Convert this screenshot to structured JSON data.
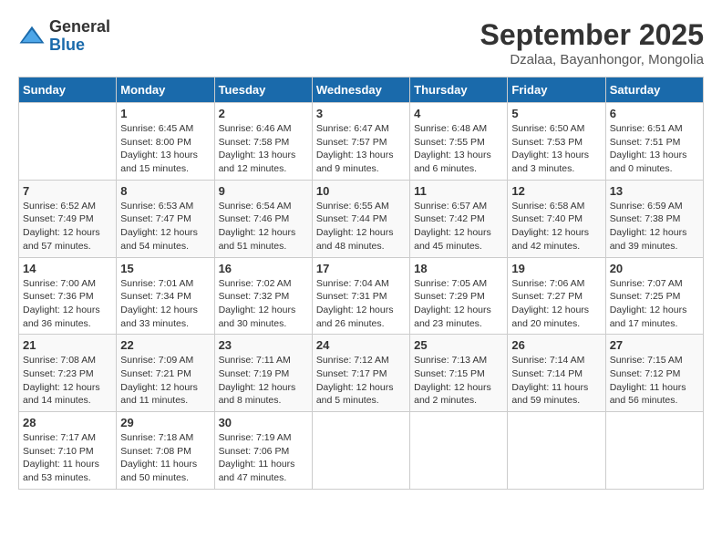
{
  "logo": {
    "general": "General",
    "blue": "Blue"
  },
  "title": "September 2025",
  "location": "Dzalaa, Bayanhongor, Mongolia",
  "headers": [
    "Sunday",
    "Monday",
    "Tuesday",
    "Wednesday",
    "Thursday",
    "Friday",
    "Saturday"
  ],
  "weeks": [
    [
      {
        "day": "",
        "info": ""
      },
      {
        "day": "1",
        "info": "Sunrise: 6:45 AM\nSunset: 8:00 PM\nDaylight: 13 hours\nand 15 minutes."
      },
      {
        "day": "2",
        "info": "Sunrise: 6:46 AM\nSunset: 7:58 PM\nDaylight: 13 hours\nand 12 minutes."
      },
      {
        "day": "3",
        "info": "Sunrise: 6:47 AM\nSunset: 7:57 PM\nDaylight: 13 hours\nand 9 minutes."
      },
      {
        "day": "4",
        "info": "Sunrise: 6:48 AM\nSunset: 7:55 PM\nDaylight: 13 hours\nand 6 minutes."
      },
      {
        "day": "5",
        "info": "Sunrise: 6:50 AM\nSunset: 7:53 PM\nDaylight: 13 hours\nand 3 minutes."
      },
      {
        "day": "6",
        "info": "Sunrise: 6:51 AM\nSunset: 7:51 PM\nDaylight: 13 hours\nand 0 minutes."
      }
    ],
    [
      {
        "day": "7",
        "info": "Sunrise: 6:52 AM\nSunset: 7:49 PM\nDaylight: 12 hours\nand 57 minutes."
      },
      {
        "day": "8",
        "info": "Sunrise: 6:53 AM\nSunset: 7:47 PM\nDaylight: 12 hours\nand 54 minutes."
      },
      {
        "day": "9",
        "info": "Sunrise: 6:54 AM\nSunset: 7:46 PM\nDaylight: 12 hours\nand 51 minutes."
      },
      {
        "day": "10",
        "info": "Sunrise: 6:55 AM\nSunset: 7:44 PM\nDaylight: 12 hours\nand 48 minutes."
      },
      {
        "day": "11",
        "info": "Sunrise: 6:57 AM\nSunset: 7:42 PM\nDaylight: 12 hours\nand 45 minutes."
      },
      {
        "day": "12",
        "info": "Sunrise: 6:58 AM\nSunset: 7:40 PM\nDaylight: 12 hours\nand 42 minutes."
      },
      {
        "day": "13",
        "info": "Sunrise: 6:59 AM\nSunset: 7:38 PM\nDaylight: 12 hours\nand 39 minutes."
      }
    ],
    [
      {
        "day": "14",
        "info": "Sunrise: 7:00 AM\nSunset: 7:36 PM\nDaylight: 12 hours\nand 36 minutes."
      },
      {
        "day": "15",
        "info": "Sunrise: 7:01 AM\nSunset: 7:34 PM\nDaylight: 12 hours\nand 33 minutes."
      },
      {
        "day": "16",
        "info": "Sunrise: 7:02 AM\nSunset: 7:32 PM\nDaylight: 12 hours\nand 30 minutes."
      },
      {
        "day": "17",
        "info": "Sunrise: 7:04 AM\nSunset: 7:31 PM\nDaylight: 12 hours\nand 26 minutes."
      },
      {
        "day": "18",
        "info": "Sunrise: 7:05 AM\nSunset: 7:29 PM\nDaylight: 12 hours\nand 23 minutes."
      },
      {
        "day": "19",
        "info": "Sunrise: 7:06 AM\nSunset: 7:27 PM\nDaylight: 12 hours\nand 20 minutes."
      },
      {
        "day": "20",
        "info": "Sunrise: 7:07 AM\nSunset: 7:25 PM\nDaylight: 12 hours\nand 17 minutes."
      }
    ],
    [
      {
        "day": "21",
        "info": "Sunrise: 7:08 AM\nSunset: 7:23 PM\nDaylight: 12 hours\nand 14 minutes."
      },
      {
        "day": "22",
        "info": "Sunrise: 7:09 AM\nSunset: 7:21 PM\nDaylight: 12 hours\nand 11 minutes."
      },
      {
        "day": "23",
        "info": "Sunrise: 7:11 AM\nSunset: 7:19 PM\nDaylight: 12 hours\nand 8 minutes."
      },
      {
        "day": "24",
        "info": "Sunrise: 7:12 AM\nSunset: 7:17 PM\nDaylight: 12 hours\nand 5 minutes."
      },
      {
        "day": "25",
        "info": "Sunrise: 7:13 AM\nSunset: 7:15 PM\nDaylight: 12 hours\nand 2 minutes."
      },
      {
        "day": "26",
        "info": "Sunrise: 7:14 AM\nSunset: 7:14 PM\nDaylight: 11 hours\nand 59 minutes."
      },
      {
        "day": "27",
        "info": "Sunrise: 7:15 AM\nSunset: 7:12 PM\nDaylight: 11 hours\nand 56 minutes."
      }
    ],
    [
      {
        "day": "28",
        "info": "Sunrise: 7:17 AM\nSunset: 7:10 PM\nDaylight: 11 hours\nand 53 minutes."
      },
      {
        "day": "29",
        "info": "Sunrise: 7:18 AM\nSunset: 7:08 PM\nDaylight: 11 hours\nand 50 minutes."
      },
      {
        "day": "30",
        "info": "Sunrise: 7:19 AM\nSunset: 7:06 PM\nDaylight: 11 hours\nand 47 minutes."
      },
      {
        "day": "",
        "info": ""
      },
      {
        "day": "",
        "info": ""
      },
      {
        "day": "",
        "info": ""
      },
      {
        "day": "",
        "info": ""
      }
    ]
  ]
}
